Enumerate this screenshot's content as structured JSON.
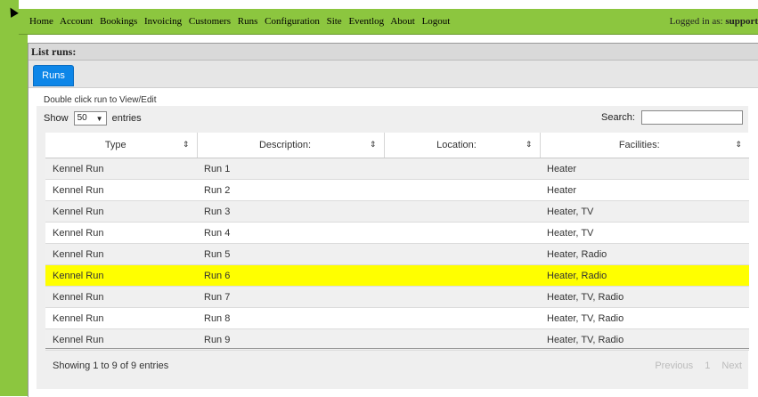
{
  "nav": {
    "items": [
      "Home",
      "Account",
      "Bookings",
      "Invoicing",
      "Customers",
      "Runs",
      "Configuration",
      "Site",
      "Eventlog",
      "About",
      "Logout"
    ],
    "logged_in_label": "Logged in as:",
    "logged_in_user": "support"
  },
  "panel": {
    "title": "List runs:",
    "tab": "Runs",
    "hint": "Double click run to View/Edit"
  },
  "datatable": {
    "show_label": "Show",
    "page_size": "50",
    "entries_label": "entries",
    "search_label": "Search:",
    "search_value": "",
    "columns": [
      "Type",
      "Description:",
      "Location:",
      "Facilities:"
    ],
    "rows": [
      {
        "type": "Kennel Run",
        "description": "Run 1",
        "location": "",
        "facilities": "Heater",
        "highlighted": false
      },
      {
        "type": "Kennel Run",
        "description": "Run 2",
        "location": "",
        "facilities": "Heater",
        "highlighted": false
      },
      {
        "type": "Kennel Run",
        "description": "Run 3",
        "location": "",
        "facilities": "Heater, TV",
        "highlighted": false
      },
      {
        "type": "Kennel Run",
        "description": "Run 4",
        "location": "",
        "facilities": "Heater, TV",
        "highlighted": false
      },
      {
        "type": "Kennel Run",
        "description": "Run 5",
        "location": "",
        "facilities": "Heater, Radio",
        "highlighted": false
      },
      {
        "type": "Kennel Run",
        "description": "Run 6",
        "location": "",
        "facilities": "Heater, Radio",
        "highlighted": true
      },
      {
        "type": "Kennel Run",
        "description": "Run 7",
        "location": "",
        "facilities": "Heater, TV, Radio",
        "highlighted": false
      },
      {
        "type": "Kennel Run",
        "description": "Run 8",
        "location": "",
        "facilities": "Heater, TV, Radio",
        "highlighted": false
      },
      {
        "type": "Kennel Run",
        "description": "Run 9",
        "location": "",
        "facilities": "Heater, TV, Radio",
        "highlighted": false
      }
    ],
    "info": "Showing 1 to 9 of 9 entries",
    "pager": {
      "previous": "Previous",
      "page": "1",
      "next": "Next"
    }
  },
  "colors": {
    "nav_green": "#8cc63f",
    "tab_blue": "#0d86e8",
    "highlight": "#ffff00"
  },
  "icons": {
    "sort": "sort-both-icon",
    "caret": "caret-down-icon",
    "cursor": "mouse-pointer-icon"
  }
}
